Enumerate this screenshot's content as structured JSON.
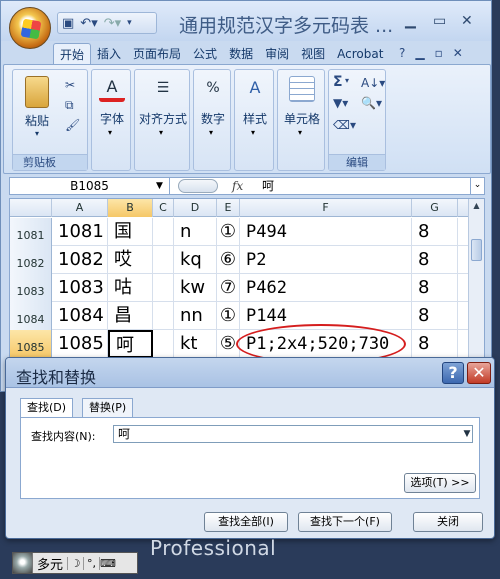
{
  "window": {
    "title": "通用规范汉字多元码表 ..."
  },
  "ribbon": {
    "tabs": [
      "开始",
      "插入",
      "页面布局",
      "公式",
      "数据",
      "审阅",
      "视图",
      "Acrobat"
    ],
    "groups": {
      "clipboard": {
        "paste": "粘贴",
        "label": "剪贴板"
      },
      "font": {
        "label": "字体"
      },
      "alignment": {
        "label": "对齐方式"
      },
      "number": {
        "label": "数字",
        "icon_text": "%"
      },
      "styles": {
        "label": "样式"
      },
      "cells": {
        "label": "单元格"
      },
      "editing": {
        "label": "编辑",
        "sum_icon": "Σ"
      }
    }
  },
  "formula_bar": {
    "name_box": "B1085",
    "fx": "fx",
    "value": "呵"
  },
  "sheet": {
    "columns": [
      "A",
      "B",
      "C",
      "D",
      "E",
      "F",
      "G"
    ],
    "rows": [
      {
        "num": "1081",
        "A": "1081",
        "B": "国",
        "C": "",
        "D": "n",
        "E": "①",
        "F": "P494",
        "G": "8"
      },
      {
        "num": "1082",
        "A": "1082",
        "B": "哎",
        "C": "",
        "D": "kq",
        "E": "⑥",
        "F": "P2",
        "G": "8"
      },
      {
        "num": "1083",
        "A": "1083",
        "B": "咕",
        "C": "",
        "D": "kw",
        "E": "⑦",
        "F": "P462",
        "G": "8"
      },
      {
        "num": "1084",
        "A": "1084",
        "B": "昌",
        "C": "",
        "D": "nn",
        "E": "①",
        "F": "P144",
        "G": "8"
      },
      {
        "num": "1085",
        "A": "1085",
        "B": "呵",
        "C": "",
        "D": "kt",
        "E": "⑤",
        "F": "P1;2x4;520;730",
        "G": "8"
      }
    ]
  },
  "dialog": {
    "title": "查找和替换",
    "tab_find": "查找(D)",
    "tab_replace": "替换(P)",
    "find_label": "查找内容(N):",
    "find_value": "呵",
    "options_btn": "选项(T) >>",
    "find_all_btn": "查找全部(I)",
    "find_next_btn": "查找下一个(F)",
    "close_btn": "关闭"
  },
  "desktop": {
    "professional": "Professional",
    "ime_text": "多元"
  },
  "colors": {
    "highlight": "#d51e1e",
    "selected_header": "#f5c767"
  }
}
